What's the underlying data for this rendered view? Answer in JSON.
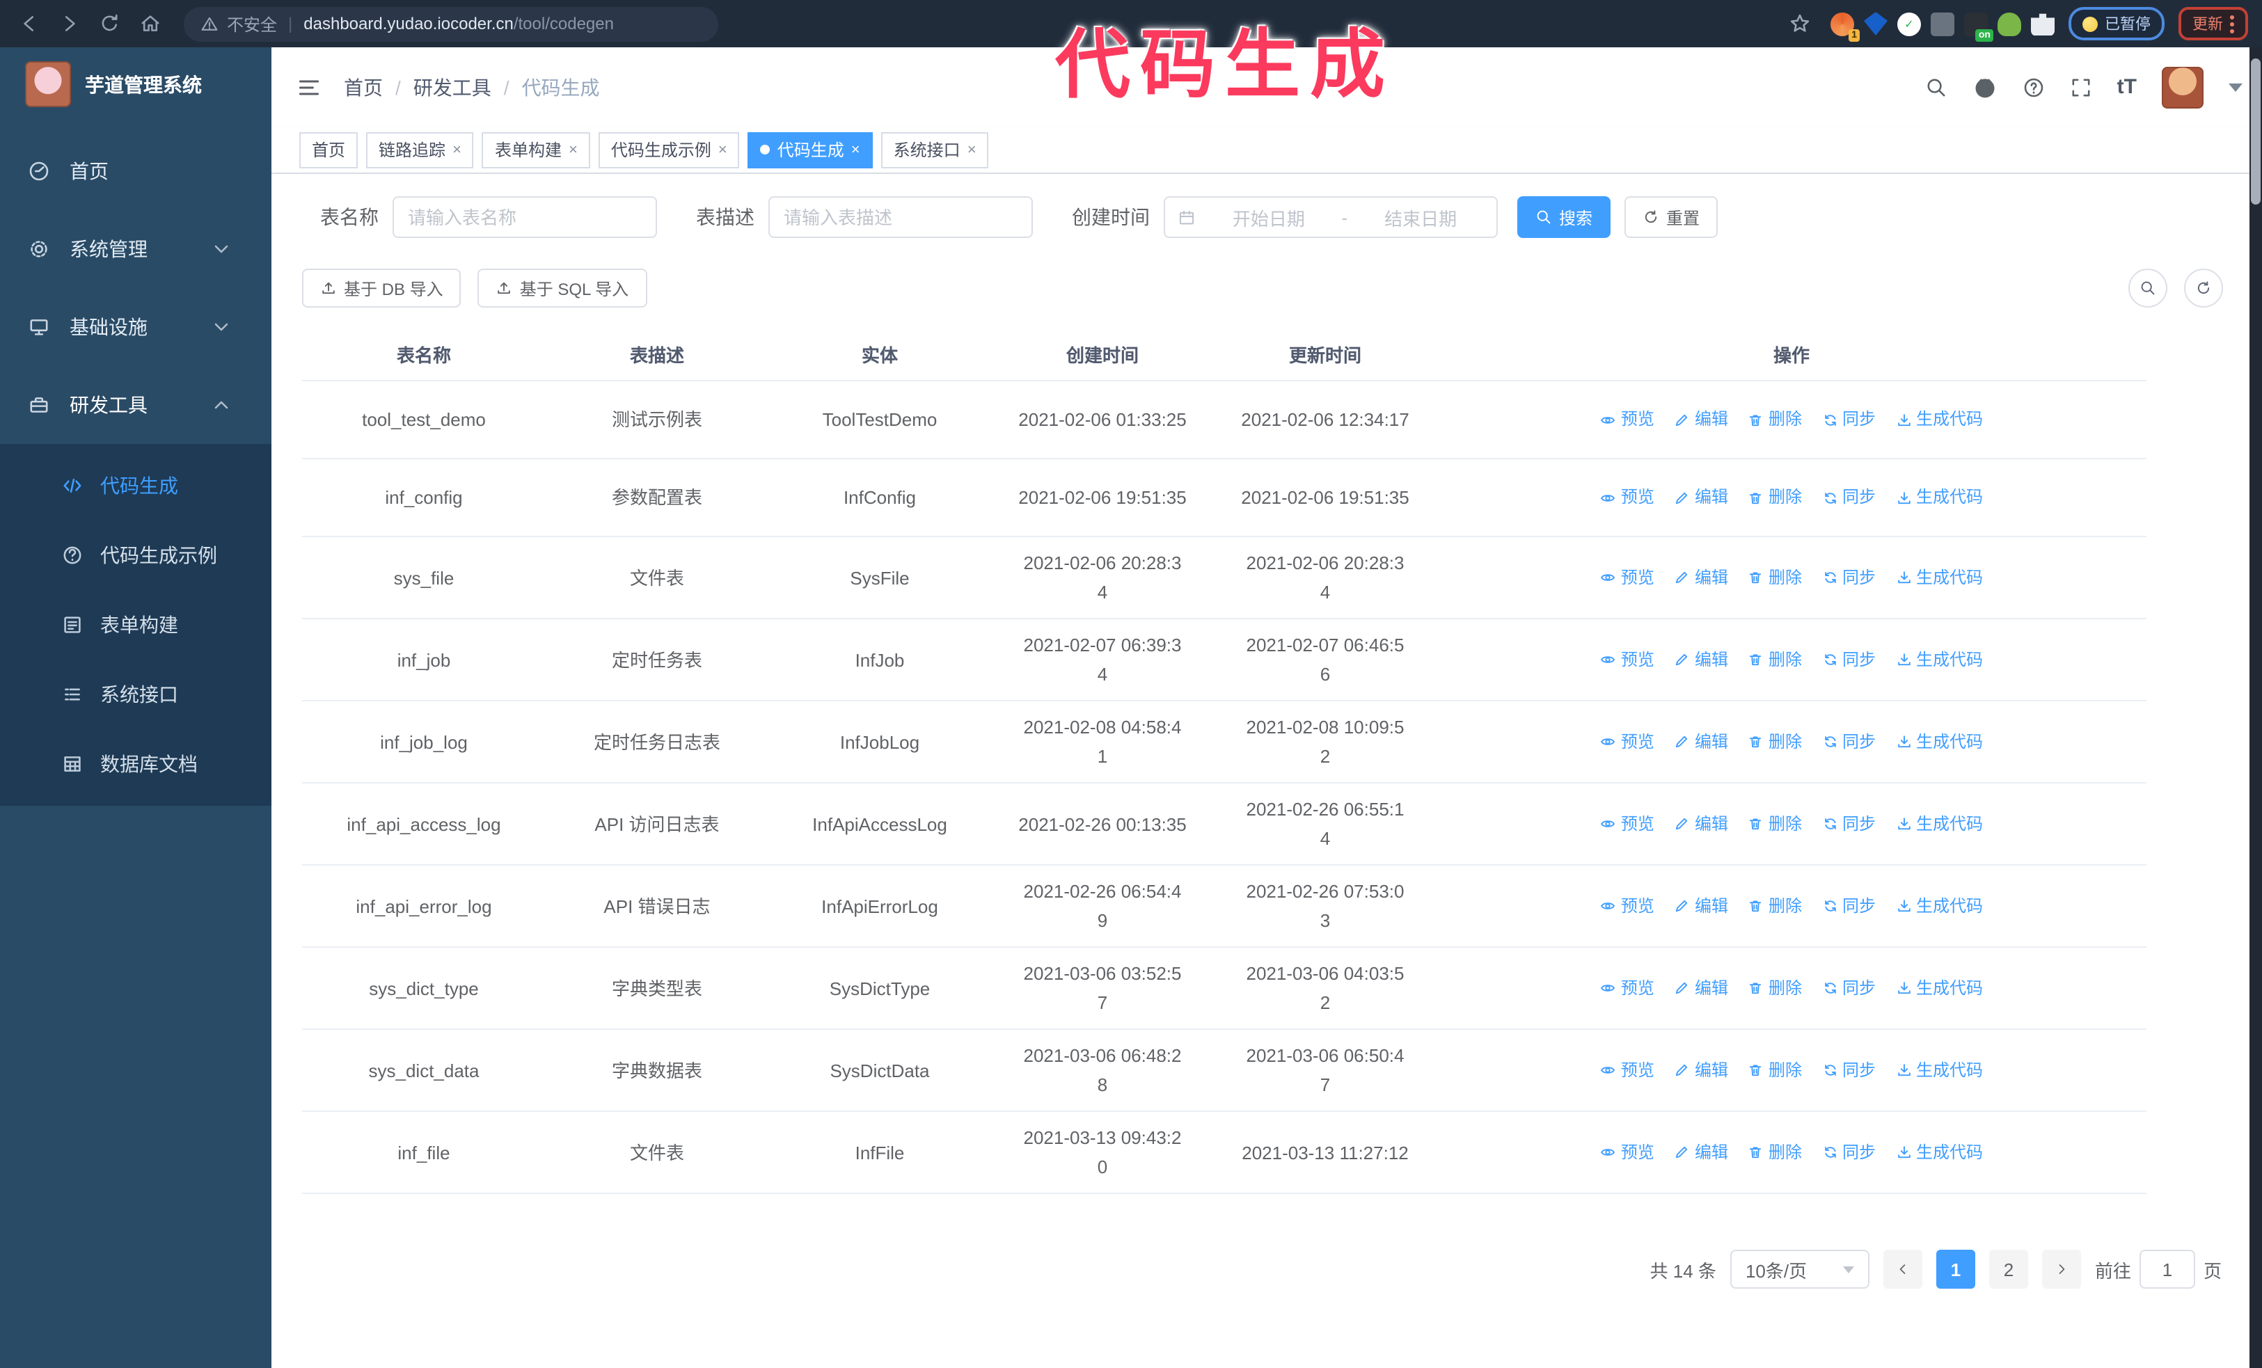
{
  "browser": {
    "security_label": "不安全",
    "url_host": "dashboard.yudao.iocoder.cn",
    "url_path": "/tool/codegen",
    "nav_icons": [
      "back-icon",
      "forward-icon",
      "reload-icon",
      "home-icon"
    ],
    "bookmark_icon": "star-icon",
    "extensions": [
      {
        "icon": "orange-sync-icon",
        "badge": "1"
      },
      {
        "icon": "blue-gem-icon",
        "badge": ""
      },
      {
        "icon": "green-check-icon",
        "badge": ""
      },
      {
        "icon": "grid-tabs-icon",
        "badge": ""
      },
      {
        "icon": "switch-on-icon",
        "badge": "on"
      },
      {
        "icon": "green-bot-icon",
        "badge": ""
      },
      {
        "icon": "puzzle-icon",
        "badge": ""
      }
    ],
    "paused_badge": "已暂停",
    "update_button": "更新"
  },
  "annotation": {
    "text": "代码生成",
    "color": "#fb3a5d"
  },
  "sidebar": {
    "title": "芋道管理系统",
    "items": [
      {
        "label": "首页",
        "icon": "dashboard-icon",
        "chevron": "",
        "expanded": false
      },
      {
        "label": "系统管理",
        "icon": "gear-icon",
        "chevron": "down",
        "expanded": false
      },
      {
        "label": "基础设施",
        "icon": "infra-icon",
        "chevron": "down",
        "expanded": false
      },
      {
        "label": "研发工具",
        "icon": "toolbox-icon",
        "chevron": "up",
        "expanded": true
      }
    ],
    "submenu": [
      {
        "label": "代码生成",
        "icon": "code-icon",
        "active": true
      },
      {
        "label": "代码生成示例",
        "icon": "example-icon",
        "active": false
      },
      {
        "label": "表单构建",
        "icon": "form-build-icon",
        "active": false
      },
      {
        "label": "系统接口",
        "icon": "api-icon",
        "active": false
      },
      {
        "label": "数据库文档",
        "icon": "db-doc-icon",
        "active": false
      }
    ]
  },
  "header": {
    "breadcrumb": [
      "首页",
      "研发工具",
      "代码生成"
    ],
    "action_icons": [
      "search-icon",
      "github-icon",
      "help-icon",
      "fullscreen-icon",
      "font-size-icon",
      "avatar",
      "chevron-down-icon"
    ]
  },
  "tabs": [
    {
      "label": "首页",
      "closable": false,
      "active": false
    },
    {
      "label": "链路追踪",
      "closable": true,
      "active": false
    },
    {
      "label": "表单构建",
      "closable": true,
      "active": false
    },
    {
      "label": "代码生成示例",
      "closable": true,
      "active": false
    },
    {
      "label": "代码生成",
      "closable": true,
      "active": true
    },
    {
      "label": "系统接口",
      "closable": true,
      "active": false
    }
  ],
  "filters": {
    "table_name_label": "表名称",
    "table_name_placeholder": "请输入表名称",
    "table_desc_label": "表描述",
    "table_desc_placeholder": "请输入表描述",
    "create_time_label": "创建时间",
    "start_placeholder": "开始日期",
    "range_separator": "-",
    "end_placeholder": "结束日期",
    "search_label": "搜索",
    "reset_label": "重置"
  },
  "toolbar": {
    "import_db_label": "基于 DB 导入",
    "import_sql_label": "基于 SQL 导入",
    "right_icons": [
      "search-icon",
      "refresh-icon"
    ]
  },
  "table": {
    "columns": [
      "表名称",
      "表描述",
      "实体",
      "创建时间",
      "更新时间",
      "操作"
    ],
    "actions": [
      {
        "label": "预览",
        "icon": "eye-icon"
      },
      {
        "label": "编辑",
        "icon": "edit-icon"
      },
      {
        "label": "删除",
        "icon": "delete-icon"
      },
      {
        "label": "同步",
        "icon": "sync-icon"
      },
      {
        "label": "生成代码",
        "icon": "download-icon"
      }
    ],
    "rows": [
      {
        "name": "tool_test_demo",
        "desc": "测试示例表",
        "entity": "ToolTestDemo",
        "created": "2021-02-06 01:33:25",
        "updated": "2021-02-06 12:34:17"
      },
      {
        "name": "inf_config",
        "desc": "参数配置表",
        "entity": "InfConfig",
        "created": "2021-02-06 19:51:35",
        "updated": "2021-02-06 19:51:35"
      },
      {
        "name": "sys_file",
        "desc": "文件表",
        "entity": "SysFile",
        "created": "2021-02-06 20:28:3\n4",
        "updated": "2021-02-06 20:28:3\n4"
      },
      {
        "name": "inf_job",
        "desc": "定时任务表",
        "entity": "InfJob",
        "created": "2021-02-07 06:39:3\n4",
        "updated": "2021-02-07 06:46:5\n6"
      },
      {
        "name": "inf_job_log",
        "desc": "定时任务日志表",
        "entity": "InfJobLog",
        "created": "2021-02-08 04:58:4\n1",
        "updated": "2021-02-08 10:09:5\n2"
      },
      {
        "name": "inf_api_access_log",
        "desc": "API 访问日志表",
        "entity": "InfApiAccessLog",
        "created": "2021-02-26 00:13:35",
        "updated": "2021-02-26 06:55:1\n4"
      },
      {
        "name": "inf_api_error_log",
        "desc": "API 错误日志",
        "entity": "InfApiErrorLog",
        "created": "2021-02-26 06:54:4\n9",
        "updated": "2021-02-26 07:53:0\n3"
      },
      {
        "name": "sys_dict_type",
        "desc": "字典类型表",
        "entity": "SysDictType",
        "created": "2021-03-06 03:52:5\n7",
        "updated": "2021-03-06 04:03:5\n2"
      },
      {
        "name": "sys_dict_data",
        "desc": "字典数据表",
        "entity": "SysDictData",
        "created": "2021-03-06 06:48:2\n8",
        "updated": "2021-03-06 06:50:4\n7"
      },
      {
        "name": "inf_file",
        "desc": "文件表",
        "entity": "InfFile",
        "created": "2021-03-13 09:43:2\n0",
        "updated": "2021-03-13 11:27:12"
      }
    ]
  },
  "pagination": {
    "total_label": "共 14 条",
    "page_size_label": "10条/页",
    "pages": [
      "1",
      "2"
    ],
    "active_page": "1",
    "goto_label": "前往",
    "goto_value": "1",
    "page_unit_label": "页"
  }
}
